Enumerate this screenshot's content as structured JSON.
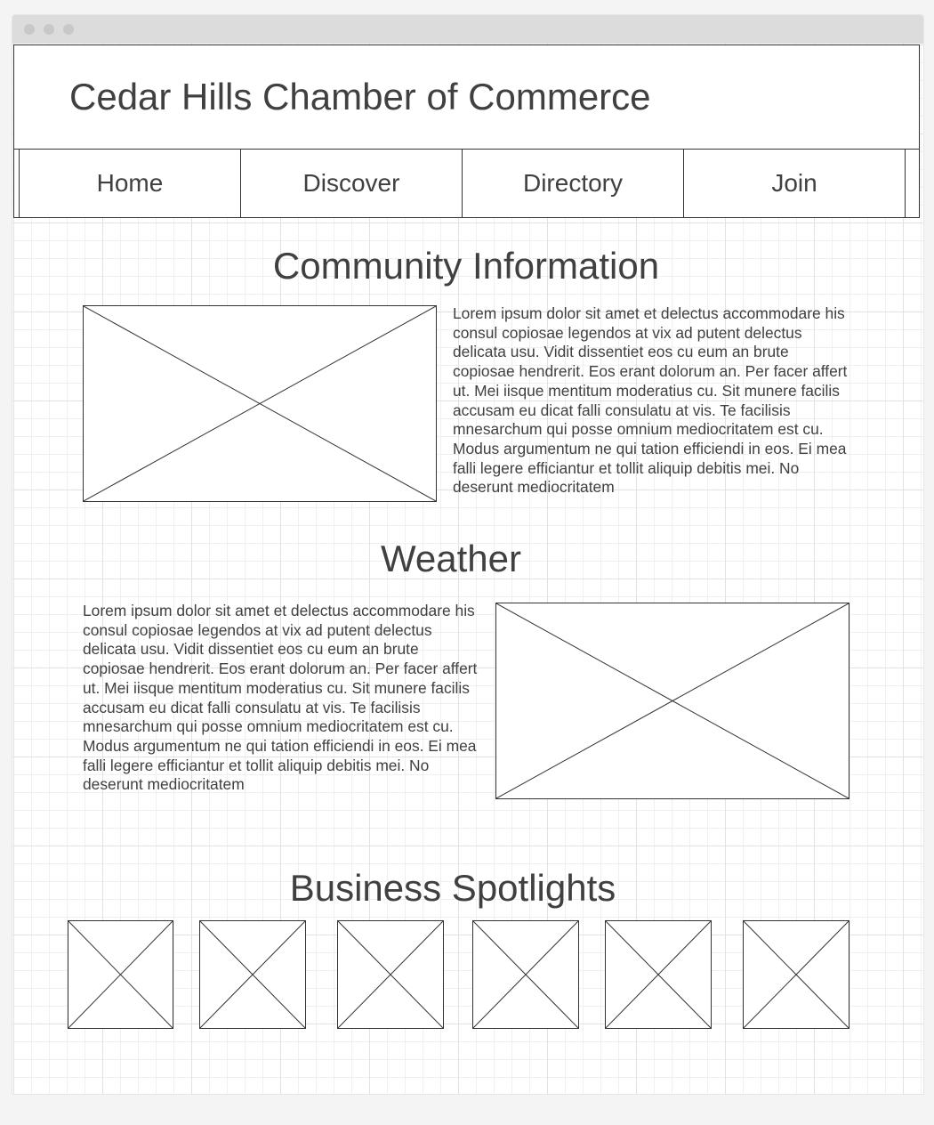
{
  "site": {
    "title": "Cedar Hills Chamber of Commerce"
  },
  "nav": {
    "items": [
      "Home",
      "Discover",
      "Directory",
      "Join"
    ]
  },
  "sections": {
    "community": {
      "title": "Community Information",
      "text": "Lorem ipsum dolor sit amet et delectus accommodare his consul copiosae legendos at vix ad putent delectus delicata usu. Vidit dissentiet eos cu eum an brute copiosae hendrerit. Eos erant dolorum an. Per facer affert ut. Mei iisque mentitum moderatius cu. Sit munere facilis accusam eu dicat falli consulatu at vis. Te facilisis mnesarchum qui posse omnium mediocritatem est cu. Modus argumentum ne qui tation efficiendi in eos. Ei mea falli legere efficiantur et tollit aliquip debitis mei. No deserunt mediocritatem"
    },
    "weather": {
      "title": "Weather",
      "text": "Lorem ipsum dolor sit amet et delectus accommodare his consul copiosae legendos at vix ad putent delectus delicata usu. Vidit dissentiet eos cu eum an brute copiosae hendrerit. Eos erant dolorum an. Per facer affert ut. Mei iisque mentitum moderatius cu. Sit munere facilis accusam eu dicat falli consulatu at vis. Te facilisis mnesarchum qui posse omnium mediocritatem est cu. Modus argumentum ne qui tation efficiendi in eos. Ei mea falli legere efficiantur et tollit aliquip debitis mei. No deserunt mediocritatem"
    },
    "spotlights": {
      "title": "Business Spotlights",
      "count": 6
    }
  }
}
